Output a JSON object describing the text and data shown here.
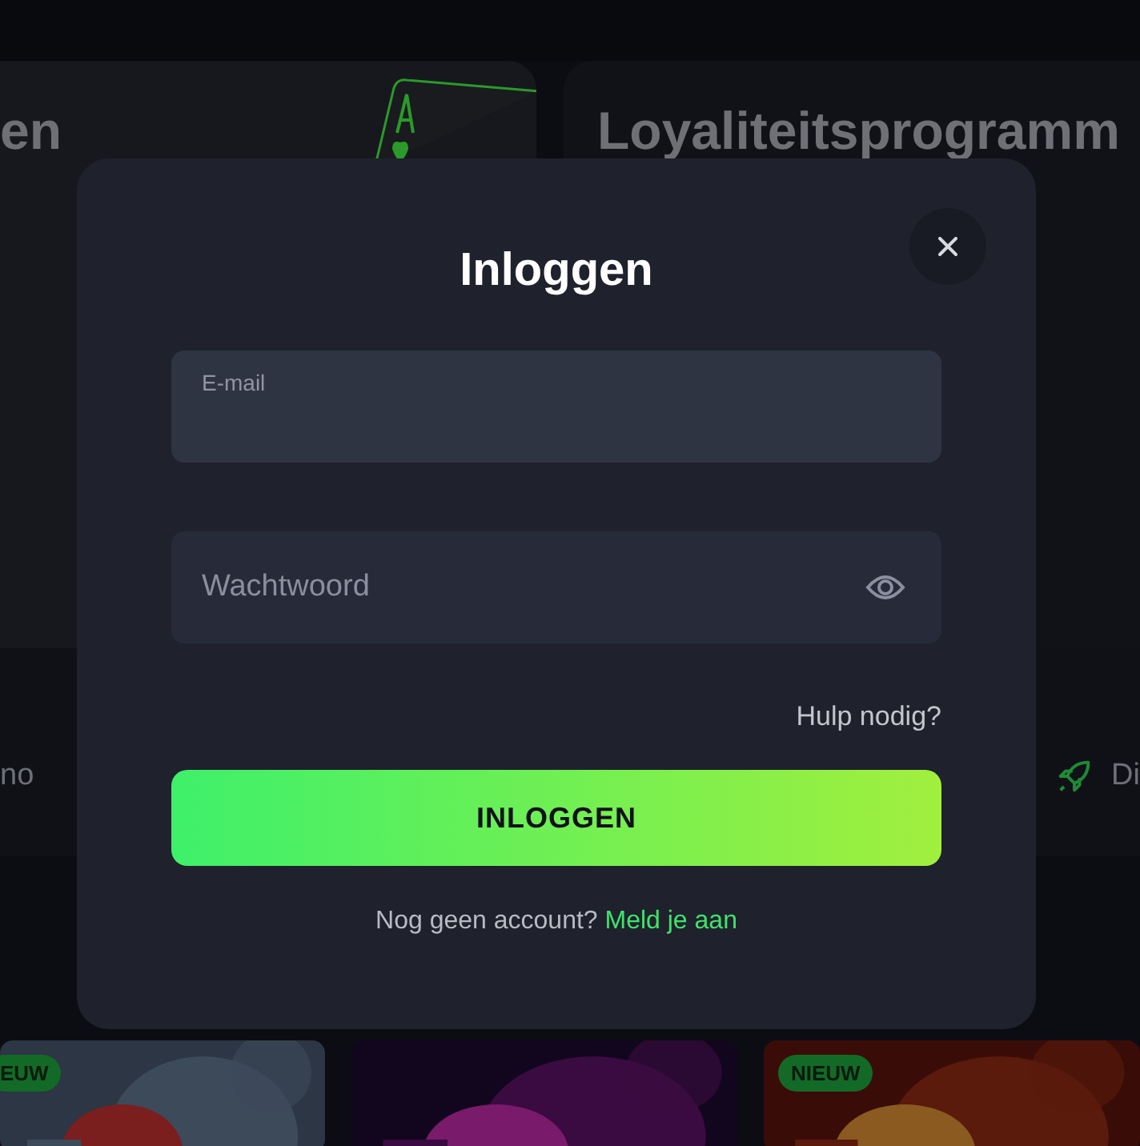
{
  "background": {
    "banners": [
      {
        "title": "en"
      },
      {
        "title": "Loyaliteitsprogramm"
      }
    ],
    "categories": [
      {
        "label": "no"
      },
      {
        "label": "Di"
      }
    ],
    "games": [
      {
        "new": true,
        "badge": "EUW"
      },
      {
        "new": false
      },
      {
        "new": true,
        "badge": "NIEUW"
      }
    ]
  },
  "modal": {
    "title": "Inloggen",
    "email": {
      "label": "E-mail"
    },
    "password": {
      "placeholder": "Wachtwoord"
    },
    "help_link": "Hulp nodig?",
    "submit": "INLOGGEN",
    "footer": {
      "text": "Nog geen account?",
      "link": "Meld je aan"
    }
  }
}
